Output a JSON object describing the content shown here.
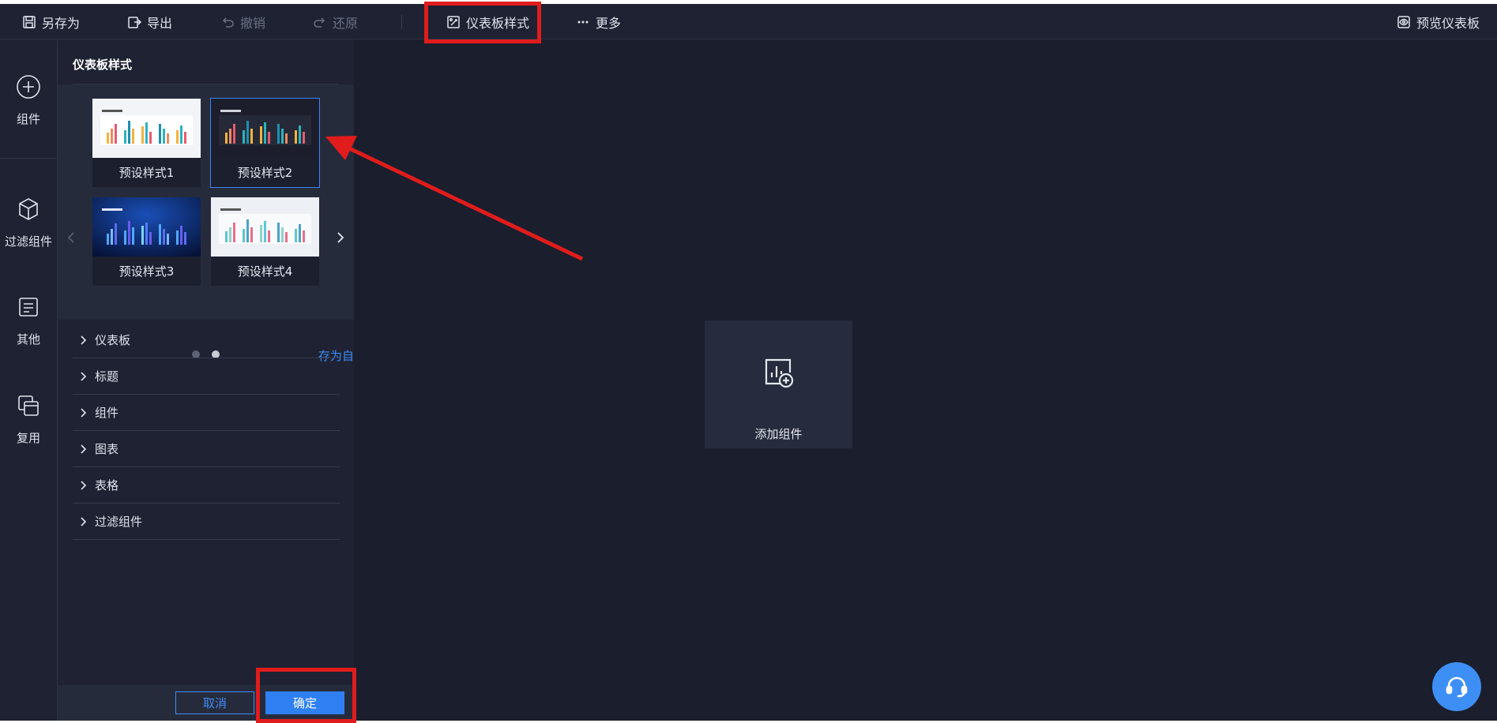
{
  "toolbar": {
    "save_as": "另存为",
    "export": "导出",
    "undo": "撤销",
    "redo": "还原",
    "dashboard_style": "仪表板样式",
    "more": "更多",
    "preview": "预览仪表板"
  },
  "rail": {
    "items": [
      {
        "label": "组件",
        "icon": "plus-circle-icon"
      },
      {
        "label": "过滤组件",
        "icon": "cube-icon"
      },
      {
        "label": "其他",
        "icon": "document-icon"
      },
      {
        "label": "复用",
        "icon": "copy-icon"
      }
    ]
  },
  "panel": {
    "title": "仪表板样式",
    "presets": [
      {
        "label": "预设样式1",
        "theme": "light"
      },
      {
        "label": "预设样式2",
        "theme": "dark",
        "selected": true
      },
      {
        "label": "预设样式3",
        "theme": "blue"
      },
      {
        "label": "预设样式4",
        "theme": "light-pastel"
      }
    ],
    "pagination": {
      "total": 2,
      "current": 2
    },
    "save_custom": "存为自定义样式",
    "sections": [
      "仪表板",
      "标题",
      "组件",
      "图表",
      "表格",
      "过滤组件"
    ],
    "cancel": "取消",
    "confirm": "确定"
  },
  "canvas": {
    "add_component": "添加组件"
  },
  "colors": {
    "accent": "#2f80f2",
    "annotation": "#e01c1c",
    "background": "#1b1e2c",
    "panel": "#1e2232"
  }
}
